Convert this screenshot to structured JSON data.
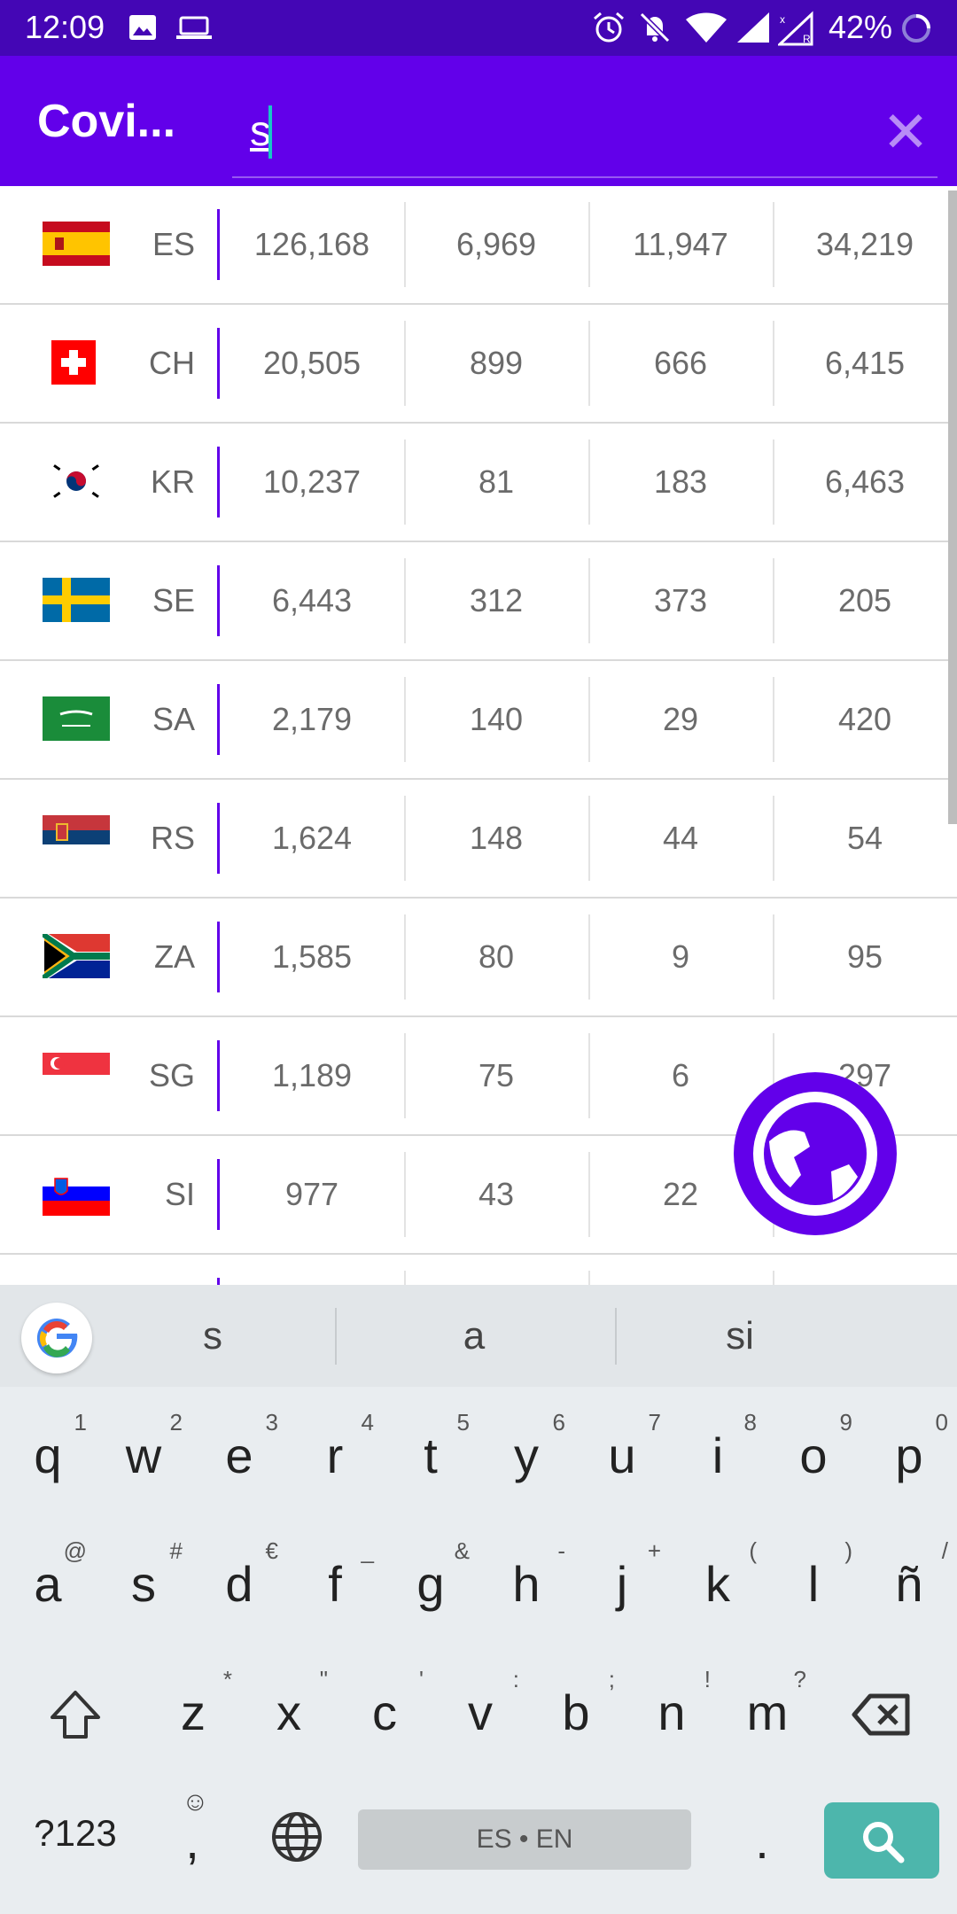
{
  "status_bar": {
    "time": "12:09",
    "battery": "42%"
  },
  "app_bar": {
    "title": "Covi...",
    "search_value": "s",
    "close_icon": "close-icon"
  },
  "rows": [
    {
      "code": "ES",
      "values": [
        "126,168",
        "6,969",
        "11,947",
        "34,219"
      ]
    },
    {
      "code": "CH",
      "values": [
        "20,505",
        "899",
        "666",
        "6,415"
      ]
    },
    {
      "code": "KR",
      "values": [
        "10,237",
        "81",
        "183",
        "6,463"
      ]
    },
    {
      "code": "SE",
      "values": [
        "6,443",
        "312",
        "373",
        "205"
      ]
    },
    {
      "code": "SA",
      "values": [
        "2,179",
        "140",
        "29",
        "420"
      ]
    },
    {
      "code": "RS",
      "values": [
        "1,624",
        "148",
        "44",
        "54"
      ]
    },
    {
      "code": "ZA",
      "values": [
        "1,585",
        "80",
        "9",
        "95"
      ]
    },
    {
      "code": "SG",
      "values": [
        "1,189",
        "75",
        "6",
        "297"
      ]
    },
    {
      "code": "SI",
      "values": [
        "977",
        "43",
        "22",
        ""
      ]
    }
  ],
  "keyboard": {
    "suggestions": [
      "s",
      "a",
      "si"
    ],
    "row1": [
      [
        "q",
        "1"
      ],
      [
        "w",
        "2"
      ],
      [
        "e",
        "3"
      ],
      [
        "r",
        "4"
      ],
      [
        "t",
        "5"
      ],
      [
        "y",
        "6"
      ],
      [
        "u",
        "7"
      ],
      [
        "i",
        "8"
      ],
      [
        "o",
        "9"
      ],
      [
        "p",
        "0"
      ]
    ],
    "row2": [
      [
        "a",
        "@"
      ],
      [
        "s",
        "#"
      ],
      [
        "d",
        "€"
      ],
      [
        "f",
        "_"
      ],
      [
        "g",
        "&"
      ],
      [
        "h",
        "-"
      ],
      [
        "j",
        "+"
      ],
      [
        "k",
        "("
      ],
      [
        "l",
        ")"
      ],
      [
        "ñ",
        "/"
      ]
    ],
    "row3": [
      [
        "z",
        "*"
      ],
      [
        "x",
        "\""
      ],
      [
        "c",
        "'"
      ],
      [
        "v",
        ":"
      ],
      [
        "b",
        ";"
      ],
      [
        "n",
        "!"
      ],
      [
        "m",
        "?"
      ]
    ],
    "symbols_label": "?123",
    "comma_label": ",",
    "period_label": ".",
    "space_label": "ES • EN"
  },
  "colors": {
    "primary": "#6200ea",
    "status": "#4406b5",
    "accent": "#18c6c6",
    "search_key": "#4db6ac"
  }
}
